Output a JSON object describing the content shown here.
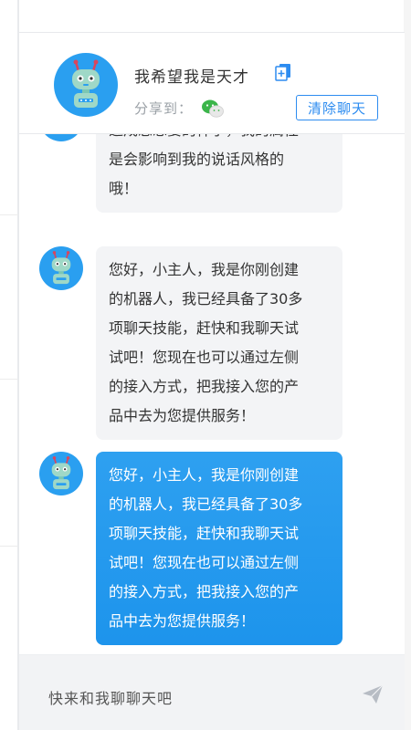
{
  "header": {
    "title": "我希望我是天才",
    "share_label": "分享到：",
    "clear_button": "清除聊天"
  },
  "messages": [
    {
      "sender": "bot",
      "style": "gray",
      "text": "造成您想要的样子，我的属性\n是会影响到我的说话风格的\n哦！"
    },
    {
      "sender": "bot",
      "style": "gray",
      "text": "您好，小主人，我是你刚创建\n的机器人，我已经具备了30多\n项聊天技能，赶快和我聊天试\n试吧！您现在也可以通过左侧\n的接入方式，把我接入您的产\n品中去为您提供服务！"
    },
    {
      "sender": "bot",
      "style": "blue",
      "text": "您好，小主人，我是你刚创建\n的机器人，我已经具备了30多\n项聊天技能，赶快和我聊天试\n试吧！您现在也可以通过左侧\n的接入方式，把我接入您的产\n品中去为您提供服务！"
    }
  ],
  "input": {
    "placeholder": "快来和我聊聊天吧"
  },
  "icons": {
    "edit": "edit-icon",
    "wechat": "wechat-icon",
    "send": "send-icon",
    "avatar": "robot-avatar-icon"
  },
  "colors": {
    "accent": "#2d8cf0",
    "bubble_blue": "#1d94ec",
    "bubble_gray": "#f3f4f6",
    "avatar_bg": "#2a9ff0"
  }
}
